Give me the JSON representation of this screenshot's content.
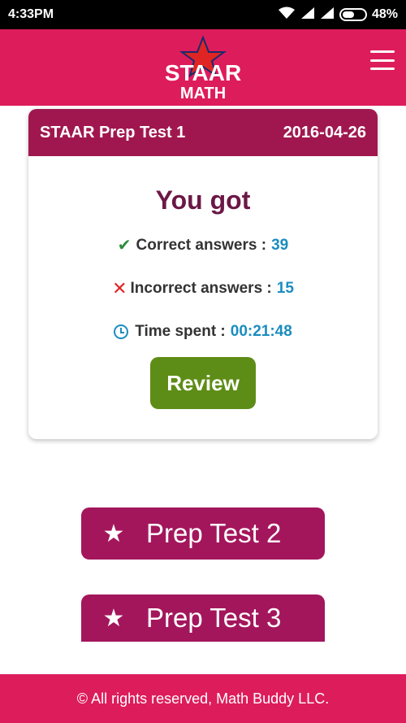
{
  "status_bar": {
    "time": "4:33PM",
    "battery": "48%"
  },
  "header": {
    "logo_text_top": "STAAR",
    "logo_text_bottom": "MATH",
    "menu_icon": "hamburger-icon"
  },
  "result_card": {
    "test_name": "STAAR Prep Test 1",
    "date": "2016-04-26",
    "heading": "You got",
    "correct_label": "Correct answers :",
    "correct_value": "39",
    "incorrect_label": "Incorrect answers :",
    "incorrect_value": "15",
    "time_label": "Time spent :",
    "time_value": "00:21:48",
    "review_label": "Review"
  },
  "prep_tests": [
    {
      "label": "Prep Test 2"
    },
    {
      "label": "Prep Test 3"
    }
  ],
  "footer": {
    "text": "© All rights reserved, Math Buddy LLC."
  },
  "colors": {
    "brand": "#dd1c5c",
    "card_header": "#a0174f",
    "review_button": "#5e8d17",
    "prep_button": "#a3165c",
    "value_blue": "#1b8dc0"
  }
}
